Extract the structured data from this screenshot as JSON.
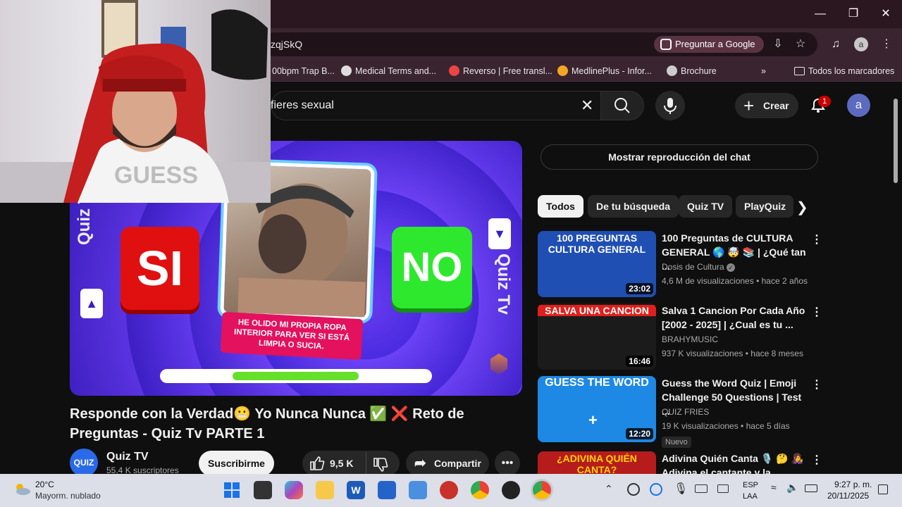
{
  "browser": {
    "url_fragment": "zqjSkQ",
    "ask_google": "Preguntar a Google",
    "profile_initial": "a",
    "bookmarks": [
      {
        "label": "00bpm Trap B...",
        "color": "#444"
      },
      {
        "label": "Medical Terms and...",
        "color": "#ddd"
      },
      {
        "label": "Reverso | Free transl...",
        "color": "#e44"
      },
      {
        "label": "MedlinePlus - Infor...",
        "color": "#f5a623"
      },
      {
        "label": "Brochure",
        "color": "#ccc"
      }
    ],
    "all_bookmarks": "Todos los marcadores"
  },
  "youtube": {
    "search_query": "fieres sexual",
    "create_label": "Crear",
    "notif_count": "1",
    "avatar_initial": "a"
  },
  "video": {
    "si": "SI",
    "no": "NO",
    "caption": "HE OLIDO MI PROPIA ROPA INTERIOR PARA VER SI ESTÁ LIMPIA O SUCIA.",
    "side_text": "Quiz Tv",
    "title": "Responde con la Verdad😬 Yo Nunca Nunca ✅ ❌ Reto de Preguntas - Quiz Tv PARTE 1",
    "progress_fraction": 0.47
  },
  "channel": {
    "logo_text": "QUIZ",
    "name": "Quiz TV",
    "subs": "55,4 K suscriptores",
    "subscribe": "Suscribirme",
    "likes": "9,5 K",
    "share": "Compartir"
  },
  "sidebar": {
    "chat_replay": "Mostrar reproducción del chat",
    "chips": [
      "Todos",
      "De tu búsqueda",
      "Quiz TV",
      "PlayQuiz"
    ],
    "recommendations": [
      {
        "thumb_text": "100 PREGUNTAS CULTURA GENERAL",
        "thumb_color": "#1f4fb3",
        "duration": "23:02",
        "title": "100 Preguntas de CULTURA GENERAL 🌎 🤯 📚 | ¿Qué tan ...",
        "channel": "Dosis de Cultura",
        "meta": "4,6 M de visualizaciones • hace 2 años",
        "badge": ""
      },
      {
        "thumb_text": "SALVA UNA CANCION",
        "thumb_color": "#1b1b1b",
        "duration": "16:46",
        "title": "Salva 1 Cancion Por Cada Año [2002 - 2025] | ¿Cual es tu ...",
        "channel": "BRAHYMUSIC",
        "meta": "937 K visualizaciones • hace 8 meses",
        "badge": ""
      },
      {
        "thumb_text": "GUESS THE WORD",
        "thumb_color": "#1e88e5",
        "duration": "12:20",
        "title": "Guess the Word Quiz | Emoji Challenge 50 Questions | Test ...",
        "channel": "QUIZ FRIES",
        "meta": "19 K visualizaciones • hace 5 días",
        "badge": "Nuevo"
      },
      {
        "thumb_text": "¿ADIVINA QUIÉN CANTA?",
        "thumb_color": "#b71c1c",
        "duration": "",
        "title": "Adivina Quién Canta 🎙️ 🤔 👩‍🎤 Adivina el cantante y la canció...",
        "channel": "",
        "meta": "",
        "badge": ""
      }
    ]
  },
  "taskbar": {
    "temp": "20°C",
    "weather": "Mayorm. nublado",
    "lang": "ESP",
    "layout": "LAA",
    "time": "9:27 p. m.",
    "date": "20/11/2025"
  }
}
